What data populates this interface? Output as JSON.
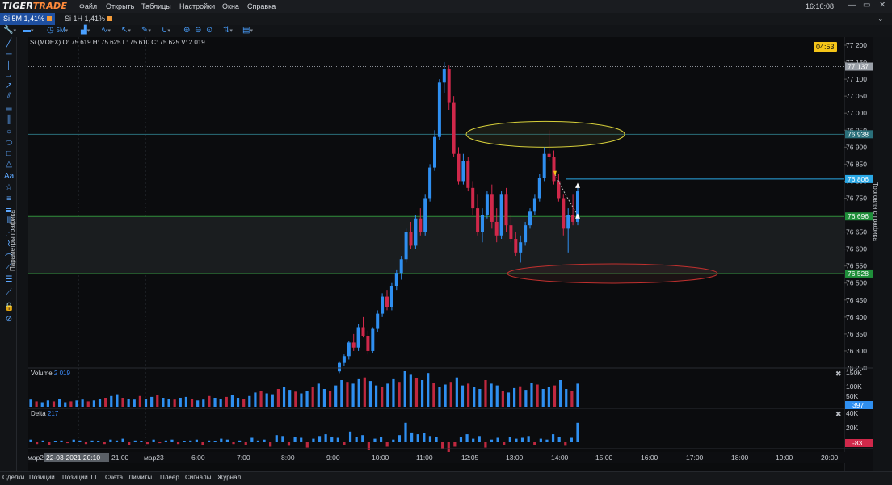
{
  "app": {
    "logo_main": "TIGER",
    "logo_accent": "TRADE"
  },
  "menu": [
    "Файл",
    "Открыть",
    "Таблицы",
    "Настройки",
    "Окна",
    "Справка"
  ],
  "clock": "16:10:08",
  "window_buttons": {
    "minimize": "—",
    "maximize": "▭",
    "close": "✕"
  },
  "tabs": [
    {
      "label": "Si 5M",
      "pct": "1,41%",
      "active": true
    },
    {
      "label": "Si 1H",
      "pct": "1,41%",
      "active": false
    }
  ],
  "toolbar": {
    "timeframe": "5M"
  },
  "side_labels": {
    "left": "Параметры графика",
    "right": "Торговля с графика"
  },
  "header": {
    "ohlc": "Si (MOEX) O: 75 619  H: 75 625  L: 75 610  C: 75 625  V: 2 019",
    "countdown": "04:53"
  },
  "price_axis": {
    "ticks": [
      "77 200",
      "77 150",
      "77 100",
      "77 050",
      "77 000",
      "76 950",
      "76 900",
      "76 850",
      "76 800",
      "76 750",
      "76 700",
      "76 650",
      "76 600",
      "76 550",
      "76 500",
      "76 450",
      "76 400",
      "76 350",
      "76 300",
      "76 250"
    ],
    "min": 76250,
    "max": 77200,
    "badges": [
      {
        "value": "77 137",
        "price": 77137,
        "color": "#9aa0a8"
      },
      {
        "value": "76 938",
        "price": 76938,
        "color": "#2a6f7a"
      },
      {
        "value": "76 806",
        "price": 76806,
        "color": "#2aa8e6"
      },
      {
        "value": "76 696",
        "price": 76696,
        "color": "#1f8f3a"
      },
      {
        "value": "76 528",
        "price": 76528,
        "color": "#1f8f3a"
      }
    ]
  },
  "volume_pane": {
    "label": "Volume",
    "value": "2 019",
    "ticks": [
      "150K",
      "100K",
      "50K"
    ],
    "badge": "397"
  },
  "delta_pane": {
    "label": "Delta",
    "value": "217",
    "ticks": [
      "40K",
      "20K",
      "0K"
    ],
    "badge": "-83"
  },
  "time_axis": {
    "labels": [
      "мар22",
      "22-03-2021 20:10",
      "21:00",
      "мар23",
      "6:00",
      "7:00",
      "8:00",
      "9:00",
      "10:00",
      "11:00",
      "12:05",
      "13:00",
      "14:00",
      "15:00",
      "16:00",
      "17:00",
      "18:00",
      "19:00",
      "20:00"
    ]
  },
  "bottom_tabs": [
    "Сделки",
    "Позиции",
    "Позиции ТТ",
    "Счета",
    "Лимиты",
    "Плеер",
    "Сигналы",
    "Журнал"
  ],
  "chart_data": {
    "type": "candlestick",
    "candles": [
      [
        76240,
        76270,
        76235,
        76265
      ],
      [
        76265,
        76290,
        76255,
        76285
      ],
      [
        76285,
        76330,
        76275,
        76325
      ],
      [
        76325,
        76350,
        76300,
        76310
      ],
      [
        76310,
        76380,
        76300,
        76370
      ],
      [
        76370,
        76400,
        76340,
        76345
      ],
      [
        76345,
        76360,
        76290,
        76300
      ],
      [
        76300,
        76370,
        76295,
        76365
      ],
      [
        76365,
        76420,
        76355,
        76410
      ],
      [
        76410,
        76470,
        76400,
        76460
      ],
      [
        76460,
        76480,
        76420,
        76430
      ],
      [
        76430,
        76500,
        76420,
        76490
      ],
      [
        76490,
        76540,
        76480,
        76530
      ],
      [
        76530,
        76580,
        76510,
        76570
      ],
      [
        76570,
        76660,
        76560,
        76650
      ],
      [
        76650,
        76680,
        76600,
        76610
      ],
      [
        76610,
        76700,
        76600,
        76690
      ],
      [
        76690,
        76720,
        76640,
        76650
      ],
      [
        76650,
        76760,
        76640,
        76750
      ],
      [
        76750,
        76850,
        76740,
        76840
      ],
      [
        76840,
        76950,
        76830,
        76930
      ],
      [
        76930,
        77100,
        76920,
        77090
      ],
      [
        77090,
        77150,
        77060,
        77130
      ],
      [
        77130,
        77140,
        77010,
        77030
      ],
      [
        77030,
        77050,
        76870,
        76880
      ],
      [
        76880,
        76900,
        76790,
        76800
      ],
      [
        76800,
        76880,
        76790,
        76860
      ],
      [
        76860,
        76870,
        76770,
        76780
      ],
      [
        76780,
        76800,
        76700,
        76720
      ],
      [
        76720,
        76760,
        76640,
        76650
      ],
      [
        76650,
        76720,
        76620,
        76700
      ],
      [
        76700,
        76770,
        76690,
        76760
      ],
      [
        76760,
        76790,
        76660,
        76680
      ],
      [
        76680,
        76720,
        76620,
        76640
      ],
      [
        76640,
        76770,
        76630,
        76760
      ],
      [
        76760,
        76780,
        76650,
        76670
      ],
      [
        76670,
        76700,
        76620,
        76630
      ],
      [
        76630,
        76650,
        76580,
        76590
      ],
      [
        76590,
        76640,
        76560,
        76620
      ],
      [
        76620,
        76680,
        76610,
        76670
      ],
      [
        76670,
        76720,
        76660,
        76710
      ],
      [
        76710,
        76760,
        76700,
        76750
      ],
      [
        76750,
        76820,
        76740,
        76810
      ],
      [
        76810,
        76900,
        76800,
        76880
      ],
      [
        76880,
        76950,
        76860,
        76870
      ],
      [
        76870,
        76890,
        76790,
        76800
      ],
      [
        76800,
        76820,
        76740,
        76750
      ],
      [
        76750,
        76760,
        76640,
        76660
      ],
      [
        76660,
        76720,
        76590,
        76700
      ],
      [
        76700,
        76760,
        76670,
        76680
      ],
      [
        76680,
        76780,
        76670,
        76770
      ]
    ],
    "volume": [
      8,
      6,
      5,
      7,
      6,
      9,
      5,
      6,
      7,
      8,
      6,
      7,
      9,
      10,
      12,
      14,
      10,
      9,
      8,
      12,
      9,
      11,
      13,
      10,
      9,
      8,
      10,
      11,
      9,
      7,
      8,
      12,
      10,
      9,
      11,
      13,
      10,
      9,
      12,
      16,
      18,
      15,
      14,
      20,
      22,
      19,
      17,
      15,
      18,
      22,
      26,
      20,
      18,
      24,
      30,
      28,
      26,
      31,
      33,
      29,
      24,
      22,
      26,
      31,
      28,
      40,
      36,
      32,
      30,
      38,
      27,
      22,
      25,
      28,
      33,
      24,
      26,
      22,
      20,
      30,
      26,
      24,
      18,
      16,
      21,
      23,
      19,
      27,
      25,
      20,
      22,
      24,
      30,
      20,
      18,
      26
    ],
    "delta": [
      3,
      -2,
      2,
      -3,
      1,
      2,
      -1,
      3,
      2,
      -2,
      2,
      1,
      -2,
      3,
      2,
      4,
      -3,
      2,
      1,
      -2,
      3,
      -1,
      2,
      3,
      -2,
      1,
      2,
      3,
      -3,
      2,
      1,
      4,
      3,
      -2,
      2,
      -3,
      5,
      2,
      3,
      -5,
      8,
      7,
      -4,
      6,
      5,
      -6,
      4,
      7,
      9,
      6,
      5,
      -3,
      12,
      6,
      8,
      -9,
      4,
      6,
      -5,
      3,
      8,
      22,
      11,
      9,
      10,
      7,
      6,
      -8,
      -12,
      -5,
      6,
      9,
      4,
      7,
      -6,
      3,
      5,
      -3,
      6,
      4,
      5,
      7,
      -3,
      4,
      3,
      9,
      6,
      -4,
      5,
      22
    ]
  }
}
